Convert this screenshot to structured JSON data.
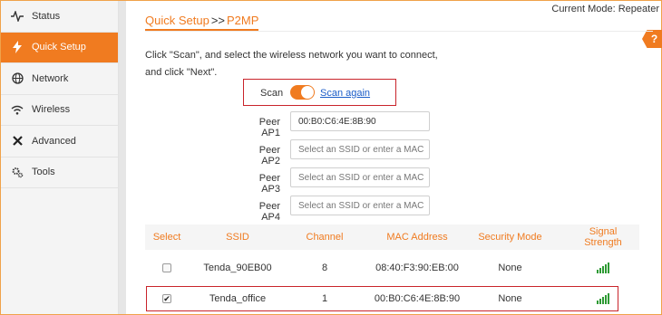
{
  "sidebar": {
    "items": [
      {
        "label": "Status",
        "icon": "pulse-icon",
        "active": false
      },
      {
        "label": "Quick Setup",
        "icon": "lightning-icon",
        "active": true
      },
      {
        "label": "Network",
        "icon": "globe-icon",
        "active": false
      },
      {
        "label": "Wireless",
        "icon": "wifi-icon",
        "active": false
      },
      {
        "label": "Advanced",
        "icon": "tools-cross-icon",
        "active": false
      },
      {
        "label": "Tools",
        "icon": "gears-icon",
        "active": false
      }
    ]
  },
  "header": {
    "current_mode": "Current Mode: Repeater",
    "help": "?"
  },
  "breadcrumb": {
    "first": "Quick Setup",
    "sep": ">>",
    "second": "P2MP"
  },
  "instructions": {
    "line1": "Click \"Scan\", and select the wireless network you want to connect,",
    "line2": "and click \"Next\"."
  },
  "scan": {
    "label": "Scan",
    "enabled": true,
    "scan_again": "Scan again"
  },
  "peers": [
    {
      "label": "Peer AP1",
      "value": "00:B0:C6:4E:8B:90",
      "placeholder": "Select an SSID or enter a MAC"
    },
    {
      "label": "Peer AP2",
      "value": "",
      "placeholder": "Select an SSID or enter a MAC"
    },
    {
      "label": "Peer AP3",
      "value": "",
      "placeholder": "Select an SSID or enter a MAC"
    },
    {
      "label": "Peer AP4",
      "value": "",
      "placeholder": "Select an SSID or enter a MAC"
    }
  ],
  "table": {
    "headers": {
      "select": "Select",
      "ssid": "SSID",
      "channel": "Channel",
      "mac": "MAC Address",
      "security": "Security Mode",
      "signal": "Signal Strength"
    },
    "rows": [
      {
        "checked": false,
        "ssid": "Tenda_90EB00",
        "channel": "8",
        "mac": "08:40:F3:90:EB:00",
        "security": "None",
        "signal_bars": 5
      },
      {
        "checked": true,
        "ssid": "Tenda_office",
        "channel": "1",
        "mac": "00:B0:C6:4E:8B:90",
        "security": "None",
        "signal_bars": 5
      }
    ]
  },
  "colors": {
    "accent": "#f07b20",
    "highlight": "#c9242b",
    "link": "#1a5cc8",
    "signal": "#2e9a34"
  }
}
